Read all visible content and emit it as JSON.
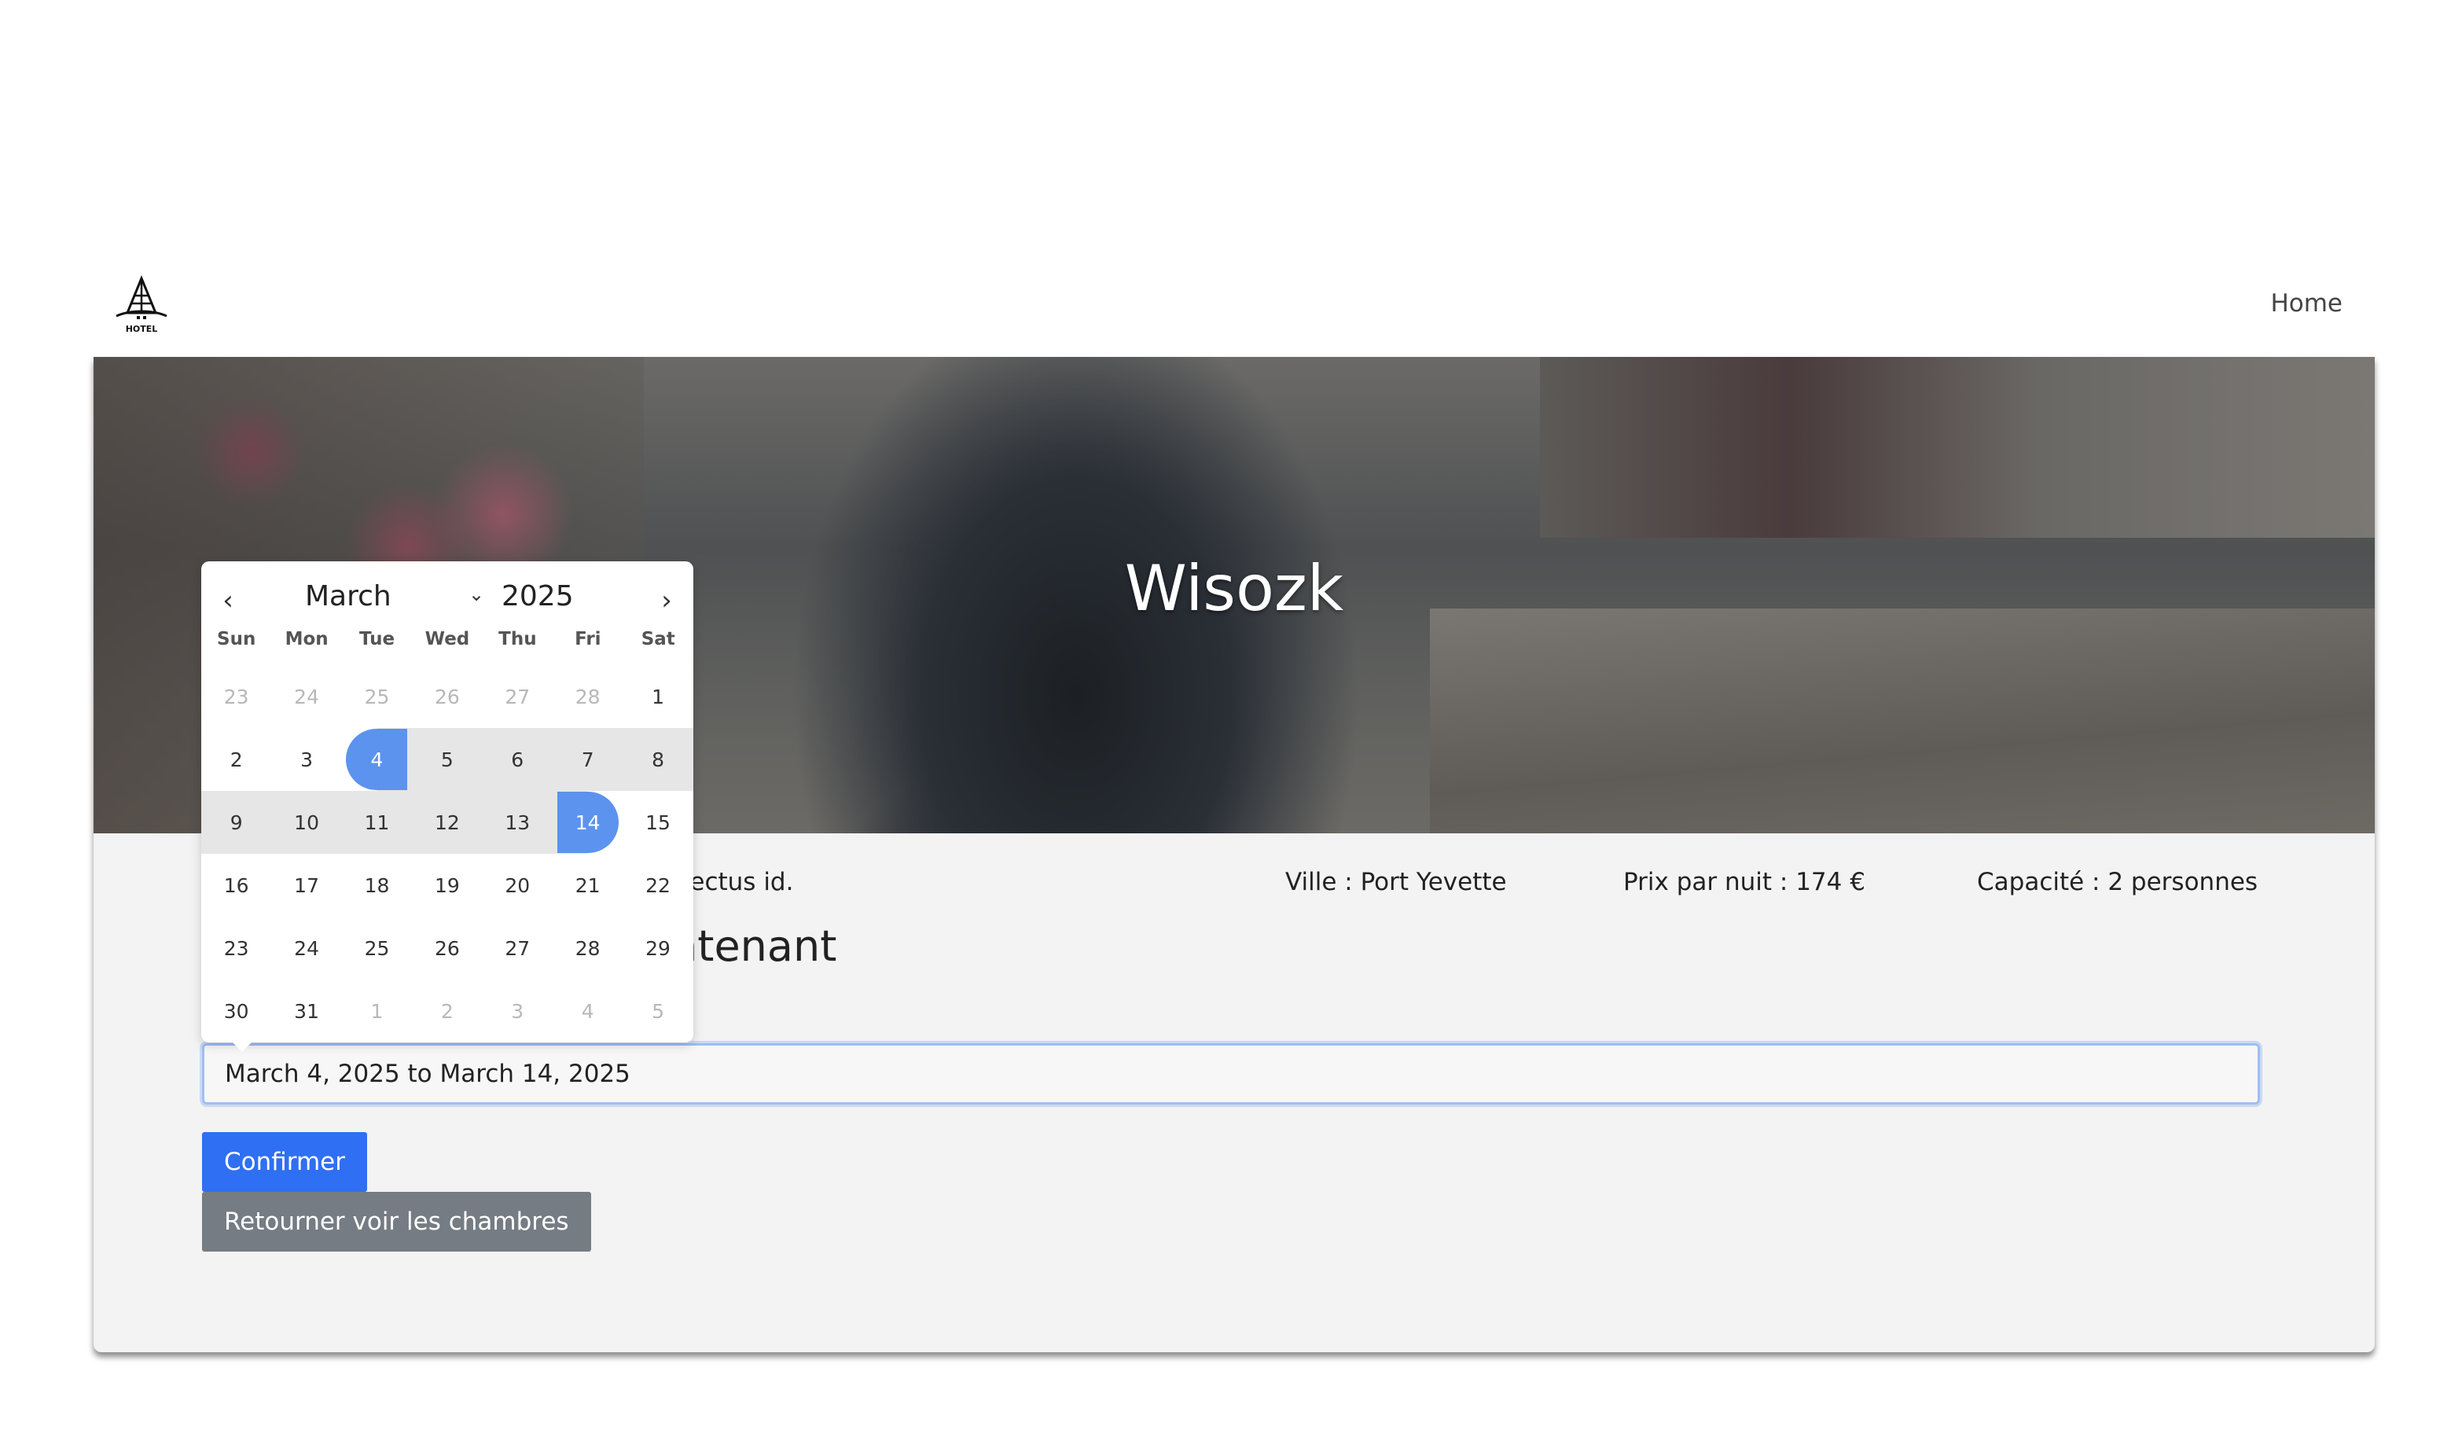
{
  "navbar": {
    "logo_text": "HOTEL",
    "home_label": "Home"
  },
  "hero": {
    "title": "Wisozk"
  },
  "info": {
    "description": "Cupiditate aliquid. Explicabo delectus id.",
    "city": "Ville : Port Yevette",
    "price": "Prix par nuit : 174 €",
    "capacity": "Capacité : 2 personnes"
  },
  "booking": {
    "heading": "Réservez dès maintenant",
    "date_value": "March 4, 2025 to March 14, 2025",
    "confirm_label": "Confirmer",
    "back_label": "Retourner voir les chambres"
  },
  "calendar": {
    "month": "March",
    "year": "2025",
    "weekdays": [
      "Sun",
      "Mon",
      "Tue",
      "Wed",
      "Thu",
      "Fri",
      "Sat"
    ],
    "weeks": [
      [
        "23",
        "24",
        "25",
        "26",
        "27",
        "28",
        "1"
      ],
      [
        "2",
        "3",
        "4",
        "5",
        "6",
        "7",
        "8"
      ],
      [
        "9",
        "10",
        "11",
        "12",
        "13",
        "14",
        "15"
      ],
      [
        "16",
        "17",
        "18",
        "19",
        "20",
        "21",
        "22"
      ],
      [
        "23",
        "24",
        "25",
        "26",
        "27",
        "28",
        "29"
      ],
      [
        "30",
        "31",
        "1",
        "2",
        "3",
        "4",
        "5"
      ]
    ],
    "range_start": "4",
    "range_end": "14",
    "colors": {
      "selected": "#5c93ee",
      "range": "#e6e6e6"
    }
  },
  "colors": {
    "primary_button": "#2f6ff3",
    "secondary_button": "#757c83"
  }
}
